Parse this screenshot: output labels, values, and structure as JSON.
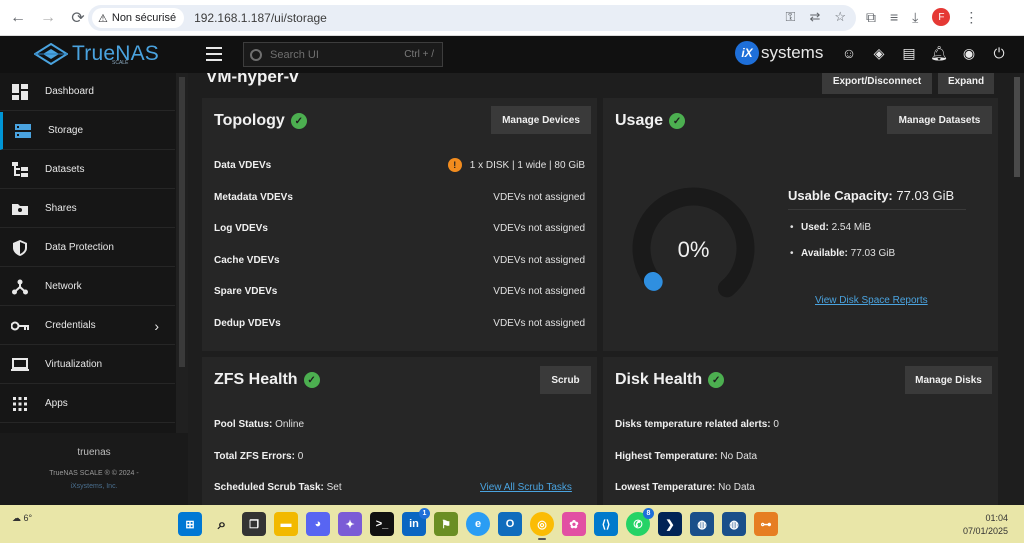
{
  "browser": {
    "security_label": "Non sécurisé",
    "url": "192.168.1.187/ui/storage",
    "profile_initial": "F"
  },
  "header": {
    "logo_text": "TrueNAS",
    "logo_sub": "SCALE",
    "search_placeholder": "Search UI",
    "search_shortcut": "Ctrl + /",
    "vendor": "systems",
    "vendor_badge": "iX"
  },
  "sidebar": {
    "items": [
      {
        "label": "Dashboard",
        "icon": "dashboard-icon"
      },
      {
        "label": "Storage",
        "icon": "storage-icon"
      },
      {
        "label": "Datasets",
        "icon": "datasets-icon"
      },
      {
        "label": "Shares",
        "icon": "shares-icon"
      },
      {
        "label": "Data Protection",
        "icon": "shield-icon"
      },
      {
        "label": "Network",
        "icon": "network-icon"
      },
      {
        "label": "Credentials",
        "icon": "key-icon"
      },
      {
        "label": "Virtualization",
        "icon": "laptop-icon"
      },
      {
        "label": "Apps",
        "icon": "apps-grid-icon"
      }
    ],
    "hostname": "truenas",
    "copyright": "TrueNAS SCALE ® © 2024 -",
    "company": "iXsystems, Inc."
  },
  "main": {
    "pool_title": "VM-hyper-v",
    "export_label": "Export/Disconnect",
    "expand_label": "Expand",
    "topology": {
      "title": "Topology",
      "button": "Manage Devices",
      "rows": [
        {
          "key": "Data VDEVs",
          "value": "1 x DISK | 1 wide | 80 GiB",
          "warn": true
        },
        {
          "key": "Metadata VDEVs",
          "value": "VDEVs not assigned"
        },
        {
          "key": "Log VDEVs",
          "value": "VDEVs not assigned"
        },
        {
          "key": "Cache VDEVs",
          "value": "VDEVs not assigned"
        },
        {
          "key": "Spare VDEVs",
          "value": "VDEVs not assigned"
        },
        {
          "key": "Dedup VDEVs",
          "value": "VDEVs not assigned"
        }
      ]
    },
    "usage": {
      "title": "Usage",
      "button": "Manage Datasets",
      "percent_text": "0%",
      "percent_value": 0.2,
      "capacity_label": "Usable Capacity:",
      "capacity_value": "77.03 GiB",
      "used_label": "Used:",
      "used_value": "2.54 MiB",
      "available_label": "Available:",
      "available_value": "77.03 GiB",
      "report_link": "View Disk Space Reports",
      "gauge_track_color": "#1a1a1a",
      "gauge_fill_color": "#2f8fe0"
    },
    "zfs_health": {
      "title": "ZFS Health",
      "button": "Scrub",
      "pool_status_label": "Pool Status:",
      "pool_status_value": "Online",
      "errors_label": "Total ZFS Errors:",
      "errors_value": "0",
      "scrub_label": "Scheduled Scrub Task:",
      "scrub_value": "Set",
      "scrub_link": "View All Scrub Tasks"
    },
    "disk_health": {
      "title": "Disk Health",
      "button": "Manage Disks",
      "temp_alerts_label": "Disks temperature related alerts:",
      "temp_alerts_value": "0",
      "highest_label": "Highest Temperature:",
      "highest_value": "No Data",
      "lowest_label": "Lowest Temperature:",
      "lowest_value": "No Data"
    }
  },
  "taskbar": {
    "weather_temp": "6°",
    "time": "01:04",
    "date": "07/01/2025",
    "linkedin_badge": "1",
    "whatsapp_badge": "8"
  }
}
